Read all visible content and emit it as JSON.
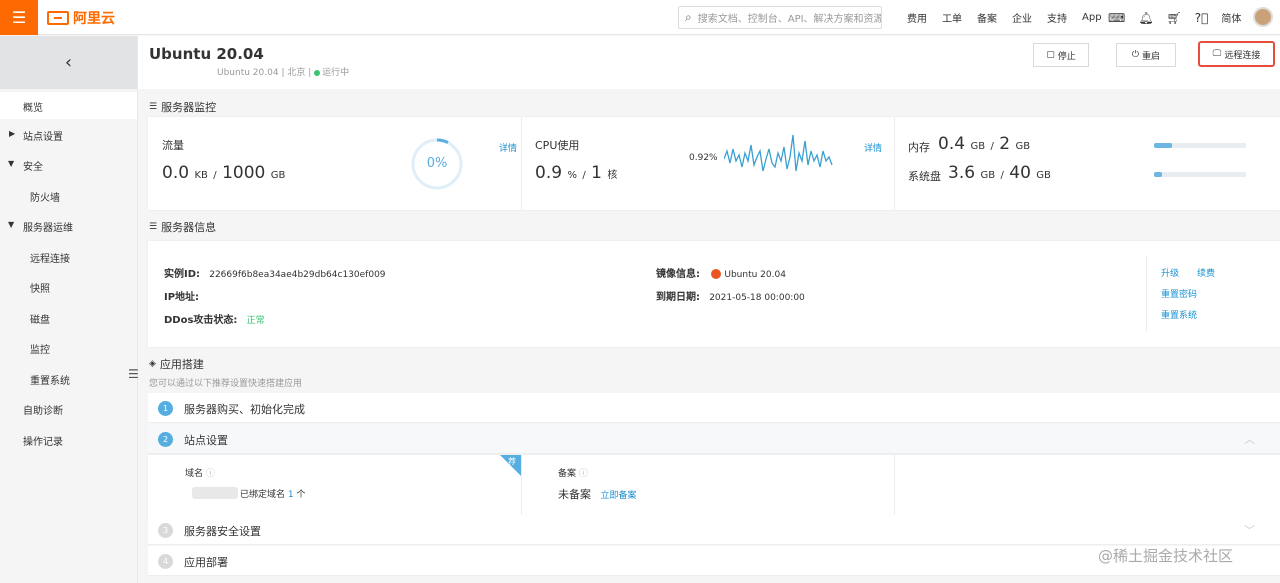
{
  "topbar": {
    "menu_icon": "hamburger-icon",
    "logo_text": "阿里云",
    "search_placeholder": "搜索文档、控制台、API、解决方案和资源",
    "nav": [
      "费用",
      "工单",
      "备案",
      "企业",
      "支持",
      "App"
    ],
    "icons": [
      "terminal-icon",
      "bell-icon",
      "cart-icon",
      "help-icon"
    ],
    "lang": "简体"
  },
  "sidebar": {
    "items": [
      {
        "label": "概览"
      },
      {
        "label": "站点设置"
      },
      {
        "label": "安全"
      },
      {
        "label": "防火墙"
      },
      {
        "label": "服务器运维"
      },
      {
        "label": "远程连接"
      },
      {
        "label": "快照"
      },
      {
        "label": "磁盘"
      },
      {
        "label": "监控"
      },
      {
        "label": "重置系统"
      },
      {
        "label": "自助诊断"
      },
      {
        "label": "操作记录"
      }
    ]
  },
  "header": {
    "title": "Ubuntu 20.04",
    "subtitle_os": "Ubuntu 20.04",
    "subtitle_region": "北京",
    "subtitle_status": "运行中",
    "btn_stop": "停止",
    "btn_restart": "重启",
    "btn_remote": "远程连接"
  },
  "monitor": {
    "section_title": "服务器监控",
    "traffic_label": "流量",
    "traffic_used": "0.0",
    "traffic_used_unit": "KB",
    "traffic_total": "1000",
    "traffic_total_unit": "GB",
    "traffic_percent": "0%",
    "detail_link": "详情",
    "cpu_label": "CPU使用",
    "cpu_used": "0.9",
    "cpu_used_unit": "%",
    "cpu_total": "1",
    "cpu_total_unit": "核",
    "cpu_current": "0.92%",
    "mem_label": "内存",
    "mem_used": "0.4",
    "mem_used_unit": "GB",
    "mem_total": "2",
    "mem_total_unit": "GB",
    "mem_fraction": 0.2,
    "disk_label": "系统盘",
    "disk_used": "3.6",
    "disk_used_unit": "GB",
    "disk_total": "40",
    "disk_total_unit": "GB",
    "disk_fraction": 0.09
  },
  "server_info": {
    "section_title": "服务器信息",
    "instance_label": "实例ID:",
    "instance_value": "22669f6b8ea34ae4b29db64c130ef009",
    "ip_label": "IP地址:",
    "ddos_label": "DDos攻击状态:",
    "ddos_value": "正常",
    "image_label": "镜像信息:",
    "image_value": "Ubuntu 20.04",
    "expire_label": "到期日期:",
    "expire_value": "2021-05-18 00:00:00",
    "link_upgrade": "升级",
    "link_renew": "续费",
    "link_reset_pwd": "重置密码",
    "link_reset_sys": "重置系统"
  },
  "app_build": {
    "section_title": "应用搭建",
    "subtitle": "您可以通过以下推荐设置快速搭建应用",
    "steps": [
      {
        "num": "1",
        "label": "服务器购买、初始化完成"
      },
      {
        "num": "2",
        "label": "站点设置"
      },
      {
        "num": "3",
        "label": "服务器安全设置"
      },
      {
        "num": "4",
        "label": "应用部署"
      }
    ],
    "domain_label": "域名",
    "domain_bound_prefix": "已绑定域名",
    "domain_bound_count": "1",
    "domain_bound_suffix": "个",
    "corner_badge": "荐",
    "icp_label": "备案",
    "icp_status": "未备案",
    "icp_link": "立即备案"
  },
  "watermark": "@稀土掘金技术社区"
}
